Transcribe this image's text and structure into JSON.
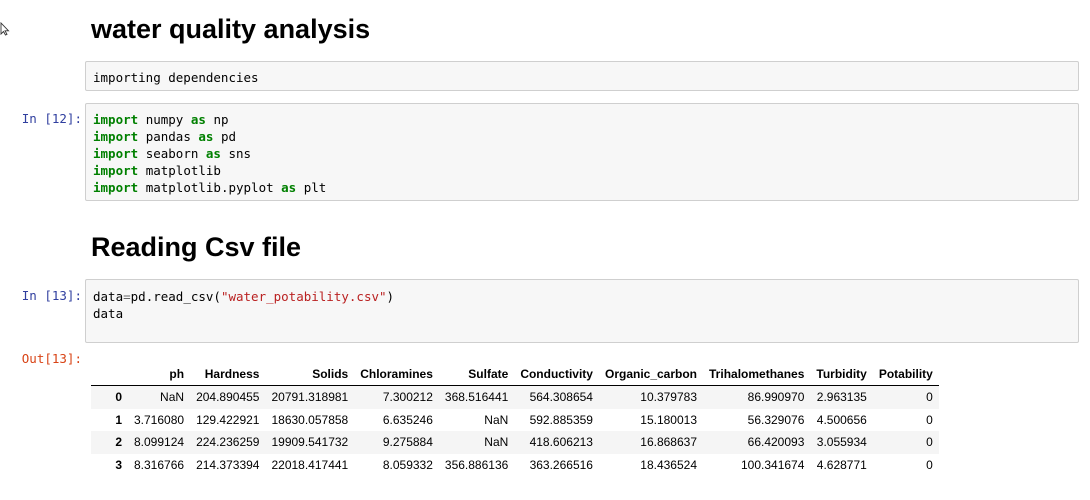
{
  "headings": {
    "title": "water quality analysis",
    "reading": "Reading Csv file"
  },
  "markdown_cell": {
    "text": "importing dependencies"
  },
  "cell_12": {
    "prompt": "In [12]:",
    "lines": [
      {
        "kw": "import",
        "mod": "numpy",
        "as": "as",
        "alias": "np"
      },
      {
        "kw": "import",
        "mod": "pandas",
        "as": "as",
        "alias": "pd"
      },
      {
        "kw": "import",
        "mod": "seaborn",
        "as": "as",
        "alias": "sns"
      },
      {
        "kw": "import",
        "mod": "matplotlib",
        "as": "",
        "alias": ""
      },
      {
        "kw": "import",
        "mod": "matplotlib.pyplot",
        "as": "as",
        "alias": "plt"
      }
    ]
  },
  "cell_13": {
    "prompt": "In [13]:",
    "line1_var": "data",
    "line1_op": "=",
    "line1_call": "pd.read_csv(",
    "line1_str": "\"water_potability.csv\"",
    "line1_close": ")",
    "line2": "data",
    "out_prompt": "Out[13]:"
  },
  "dataframe": {
    "columns": [
      "",
      "ph",
      "Hardness",
      "Solids",
      "Chloramines",
      "Sulfate",
      "Conductivity",
      "Organic_carbon",
      "Trihalomethanes",
      "Turbidity",
      "Potability"
    ],
    "rows": [
      [
        "0",
        "NaN",
        "204.890455",
        "20791.318981",
        "7.300212",
        "368.516441",
        "564.308654",
        "10.379783",
        "86.990970",
        "2.963135",
        "0"
      ],
      [
        "1",
        "3.716080",
        "129.422921",
        "18630.057858",
        "6.635246",
        "NaN",
        "592.885359",
        "15.180013",
        "56.329076",
        "4.500656",
        "0"
      ],
      [
        "2",
        "8.099124",
        "224.236259",
        "19909.541732",
        "9.275884",
        "NaN",
        "418.606213",
        "16.868637",
        "66.420093",
        "3.055934",
        "0"
      ],
      [
        "3",
        "8.316766",
        "214.373394",
        "22018.417441",
        "8.059332",
        "356.886136",
        "363.266516",
        "18.436524",
        "100.341674",
        "4.628771",
        "0"
      ]
    ]
  }
}
